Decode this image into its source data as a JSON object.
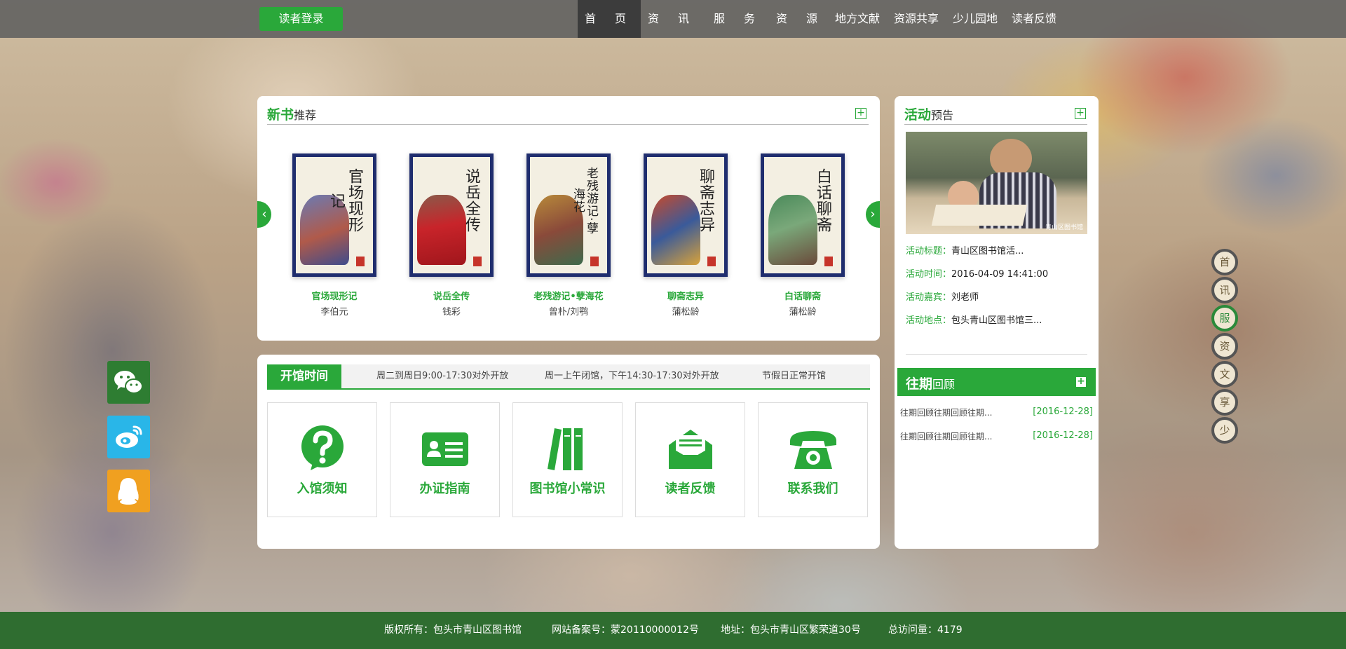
{
  "header": {
    "login_label": "读者登录",
    "nav": [
      "首页",
      "资讯",
      "服务",
      "资源",
      "地方文献",
      "资源共享",
      "少儿园地",
      "读者反馈"
    ],
    "active_nav": "首页"
  },
  "new_books": {
    "title_highlight": "新书",
    "title_rest": "推荐",
    "more": "+",
    "prev": "‹",
    "next": "›",
    "items": [
      {
        "title": "官场现形记",
        "author": "李伯元",
        "cover_text": "官场现形记"
      },
      {
        "title": "说岳全传",
        "author": "钱彩",
        "cover_text": "说岳全传"
      },
      {
        "title": "老残游记•孽海花",
        "author": "曾朴/刘鹗",
        "cover_text": "老残游记·孽海花"
      },
      {
        "title": "聊斋志异",
        "author": "蒲松龄",
        "cover_text": "聊斋志异"
      },
      {
        "title": "白话聊斋",
        "author": "蒲松龄",
        "cover_text": "白话聊斋"
      }
    ]
  },
  "hours": {
    "label": "开馆时间",
    "items": [
      "周二到周日9:00-17:30对外开放",
      "周一上午闭馆，下午14:30-17:30对外开放",
      "节假日正常开馆"
    ]
  },
  "services": [
    {
      "label": "入馆须知",
      "icon": "question-icon"
    },
    {
      "label": "办证指南",
      "icon": "id-card-icon"
    },
    {
      "label": "图书馆小常识",
      "icon": "books-icon"
    },
    {
      "label": "读者反馈",
      "icon": "envelope-icon"
    },
    {
      "label": "联系我们",
      "icon": "telephone-icon"
    }
  ],
  "activity": {
    "title_highlight": "活动",
    "title_rest": "预告",
    "more": "+",
    "photo_watermark": "青山区图书馆",
    "rows": [
      {
        "key": "活动标题：",
        "value": "青山区图书馆活..."
      },
      {
        "key": "活动时间：",
        "value": "2016-04-09 14:41:00"
      },
      {
        "key": "活动嘉宾：",
        "value": "刘老师"
      },
      {
        "key": "活动地点：",
        "value": "包头青山区图书馆三..."
      }
    ]
  },
  "past": {
    "title_highlight": "往期",
    "title_rest": "回顾",
    "more": "+",
    "items": [
      {
        "text": "往期回顾往期回顾往期...",
        "date": "[2016-12-28]"
      },
      {
        "text": "往期回顾往期回顾往期...",
        "date": "[2016-12-28]"
      }
    ]
  },
  "side_menu": [
    "首",
    "讯",
    "服",
    "资",
    "文",
    "享",
    "少"
  ],
  "social": [
    {
      "name": "wechat-icon",
      "color": "#2e7d32"
    },
    {
      "name": "weibo-icon",
      "color": "#29b6e8"
    },
    {
      "name": "qq-icon",
      "color": "#f0a020"
    }
  ],
  "footer": {
    "copyright": "版权所有：包头市青山区图书馆",
    "icp": "网站备案号：蒙20110000012号",
    "address": "地址：包头市青山区繁荣道30号",
    "visits": "总访问量：4179"
  },
  "colors": {
    "accent": "#2aa83a",
    "footer": "#2f6d30",
    "nav_bg": "#5f5f5f",
    "nav_active": "#3c3c3c"
  }
}
